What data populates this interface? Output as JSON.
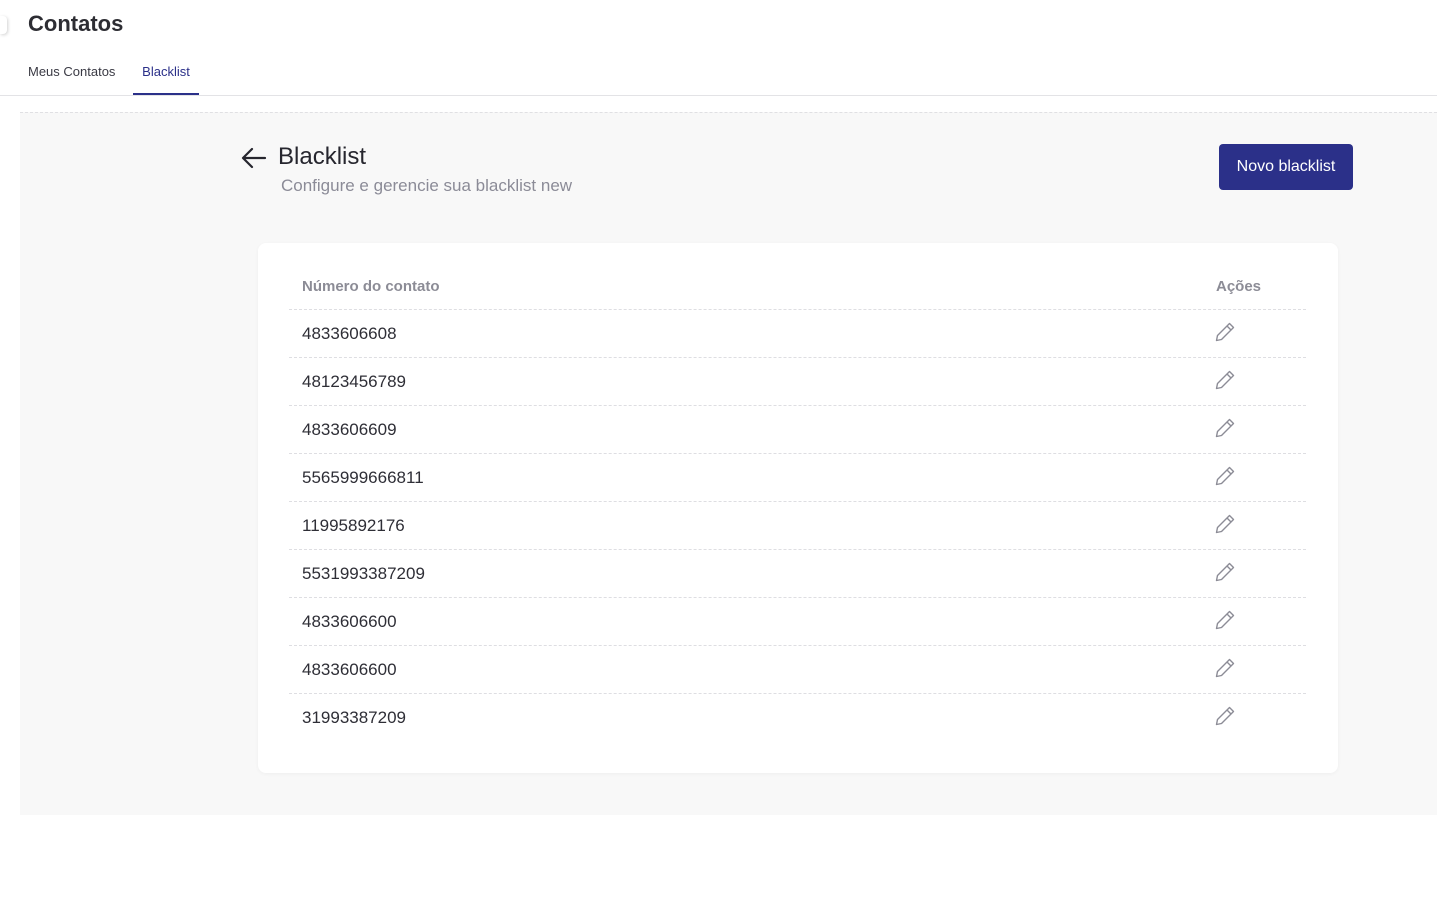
{
  "app": {
    "title": "Contatos"
  },
  "tabs": [
    {
      "label": "Meus Contatos",
      "active": false
    },
    {
      "label": "Blacklist",
      "active": true
    }
  ],
  "header": {
    "title": "Blacklist",
    "subtitle": "Configure e gerencie sua blacklist new",
    "new_button_label": "Novo blacklist",
    "back_icon": "arrow-left-icon"
  },
  "table": {
    "columns": [
      "Número do contato",
      "Ações"
    ],
    "rows": [
      {
        "number": "4833606608"
      },
      {
        "number": "48123456789"
      },
      {
        "number": "4833606609"
      },
      {
        "number": "5565999666811"
      },
      {
        "number": "11995892176"
      },
      {
        "number": "5531993387209"
      },
      {
        "number": "4833606600"
      },
      {
        "number": "4833606600"
      },
      {
        "number": "31993387209"
      }
    ],
    "row_action_icon": "pencil-icon"
  },
  "colors": {
    "accent": "#2b3089",
    "content_background": "#f8f8f8",
    "muted_text": "#8c8c96"
  }
}
